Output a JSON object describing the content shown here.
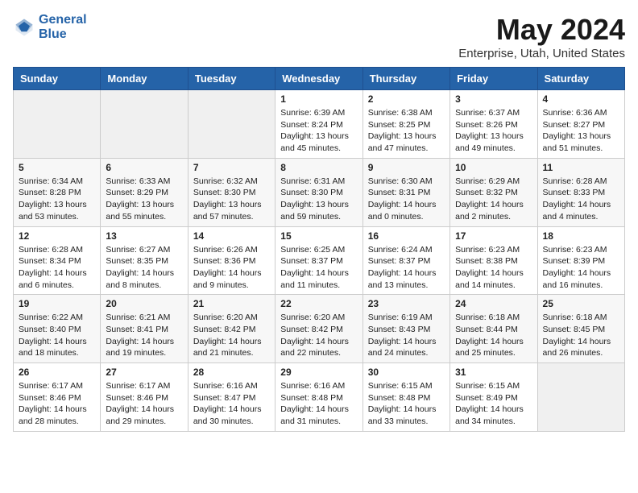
{
  "header": {
    "logo_line1": "General",
    "logo_line2": "Blue",
    "month_title": "May 2024",
    "location": "Enterprise, Utah, United States"
  },
  "weekdays": [
    "Sunday",
    "Monday",
    "Tuesday",
    "Wednesday",
    "Thursday",
    "Friday",
    "Saturday"
  ],
  "weeks": [
    [
      {
        "day": "",
        "info": ""
      },
      {
        "day": "",
        "info": ""
      },
      {
        "day": "",
        "info": ""
      },
      {
        "day": "1",
        "info": "Sunrise: 6:39 AM\nSunset: 8:24 PM\nDaylight: 13 hours\nand 45 minutes."
      },
      {
        "day": "2",
        "info": "Sunrise: 6:38 AM\nSunset: 8:25 PM\nDaylight: 13 hours\nand 47 minutes."
      },
      {
        "day": "3",
        "info": "Sunrise: 6:37 AM\nSunset: 8:26 PM\nDaylight: 13 hours\nand 49 minutes."
      },
      {
        "day": "4",
        "info": "Sunrise: 6:36 AM\nSunset: 8:27 PM\nDaylight: 13 hours\nand 51 minutes."
      }
    ],
    [
      {
        "day": "5",
        "info": "Sunrise: 6:34 AM\nSunset: 8:28 PM\nDaylight: 13 hours\nand 53 minutes."
      },
      {
        "day": "6",
        "info": "Sunrise: 6:33 AM\nSunset: 8:29 PM\nDaylight: 13 hours\nand 55 minutes."
      },
      {
        "day": "7",
        "info": "Sunrise: 6:32 AM\nSunset: 8:30 PM\nDaylight: 13 hours\nand 57 minutes."
      },
      {
        "day": "8",
        "info": "Sunrise: 6:31 AM\nSunset: 8:30 PM\nDaylight: 13 hours\nand 59 minutes."
      },
      {
        "day": "9",
        "info": "Sunrise: 6:30 AM\nSunset: 8:31 PM\nDaylight: 14 hours\nand 0 minutes."
      },
      {
        "day": "10",
        "info": "Sunrise: 6:29 AM\nSunset: 8:32 PM\nDaylight: 14 hours\nand 2 minutes."
      },
      {
        "day": "11",
        "info": "Sunrise: 6:28 AM\nSunset: 8:33 PM\nDaylight: 14 hours\nand 4 minutes."
      }
    ],
    [
      {
        "day": "12",
        "info": "Sunrise: 6:28 AM\nSunset: 8:34 PM\nDaylight: 14 hours\nand 6 minutes."
      },
      {
        "day": "13",
        "info": "Sunrise: 6:27 AM\nSunset: 8:35 PM\nDaylight: 14 hours\nand 8 minutes."
      },
      {
        "day": "14",
        "info": "Sunrise: 6:26 AM\nSunset: 8:36 PM\nDaylight: 14 hours\nand 9 minutes."
      },
      {
        "day": "15",
        "info": "Sunrise: 6:25 AM\nSunset: 8:37 PM\nDaylight: 14 hours\nand 11 minutes."
      },
      {
        "day": "16",
        "info": "Sunrise: 6:24 AM\nSunset: 8:37 PM\nDaylight: 14 hours\nand 13 minutes."
      },
      {
        "day": "17",
        "info": "Sunrise: 6:23 AM\nSunset: 8:38 PM\nDaylight: 14 hours\nand 14 minutes."
      },
      {
        "day": "18",
        "info": "Sunrise: 6:23 AM\nSunset: 8:39 PM\nDaylight: 14 hours\nand 16 minutes."
      }
    ],
    [
      {
        "day": "19",
        "info": "Sunrise: 6:22 AM\nSunset: 8:40 PM\nDaylight: 14 hours\nand 18 minutes."
      },
      {
        "day": "20",
        "info": "Sunrise: 6:21 AM\nSunset: 8:41 PM\nDaylight: 14 hours\nand 19 minutes."
      },
      {
        "day": "21",
        "info": "Sunrise: 6:20 AM\nSunset: 8:42 PM\nDaylight: 14 hours\nand 21 minutes."
      },
      {
        "day": "22",
        "info": "Sunrise: 6:20 AM\nSunset: 8:42 PM\nDaylight: 14 hours\nand 22 minutes."
      },
      {
        "day": "23",
        "info": "Sunrise: 6:19 AM\nSunset: 8:43 PM\nDaylight: 14 hours\nand 24 minutes."
      },
      {
        "day": "24",
        "info": "Sunrise: 6:18 AM\nSunset: 8:44 PM\nDaylight: 14 hours\nand 25 minutes."
      },
      {
        "day": "25",
        "info": "Sunrise: 6:18 AM\nSunset: 8:45 PM\nDaylight: 14 hours\nand 26 minutes."
      }
    ],
    [
      {
        "day": "26",
        "info": "Sunrise: 6:17 AM\nSunset: 8:46 PM\nDaylight: 14 hours\nand 28 minutes."
      },
      {
        "day": "27",
        "info": "Sunrise: 6:17 AM\nSunset: 8:46 PM\nDaylight: 14 hours\nand 29 minutes."
      },
      {
        "day": "28",
        "info": "Sunrise: 6:16 AM\nSunset: 8:47 PM\nDaylight: 14 hours\nand 30 minutes."
      },
      {
        "day": "29",
        "info": "Sunrise: 6:16 AM\nSunset: 8:48 PM\nDaylight: 14 hours\nand 31 minutes."
      },
      {
        "day": "30",
        "info": "Sunrise: 6:15 AM\nSunset: 8:48 PM\nDaylight: 14 hours\nand 33 minutes."
      },
      {
        "day": "31",
        "info": "Sunrise: 6:15 AM\nSunset: 8:49 PM\nDaylight: 14 hours\nand 34 minutes."
      },
      {
        "day": "",
        "info": ""
      }
    ]
  ]
}
